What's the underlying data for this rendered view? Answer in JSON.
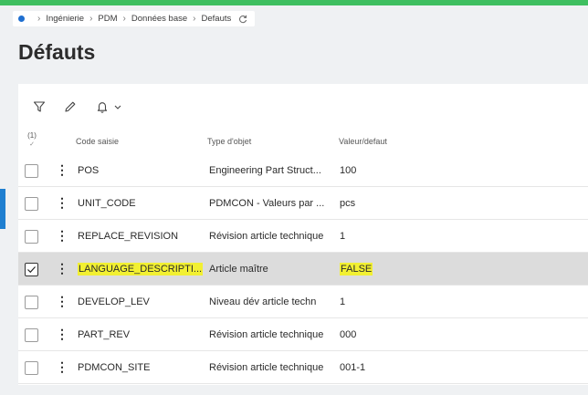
{
  "breadcrumb": {
    "items": [
      "Ingénierie",
      "PDM",
      "Données base",
      "Defauts"
    ]
  },
  "page": {
    "title": "Défauts"
  },
  "toolbar": {
    "icons": [
      "filter-icon",
      "pencil-icon",
      "bell-icon",
      "chevron-down-icon"
    ]
  },
  "table": {
    "selection_count": "(1)",
    "columns": [
      "Code saisie",
      "Type d'objet",
      "Valeur/defaut"
    ],
    "rows": [
      {
        "code": "POS",
        "type": "Engineering Part Struct...",
        "value": "100",
        "checked": false
      },
      {
        "code": "UNIT_CODE",
        "type": "PDMCON - Valeurs par ...",
        "value": "pcs",
        "checked": false
      },
      {
        "code": "REPLACE_REVISION",
        "type": "Révision article technique",
        "value": "1",
        "checked": false
      },
      {
        "code": "LANGUAGE_DESCRIPTI...",
        "type": "Article maître",
        "value": "FALSE",
        "checked": true
      },
      {
        "code": "DEVELOP_LEV",
        "type": "Niveau dév article techn",
        "value": "1",
        "checked": false
      },
      {
        "code": "PART_REV",
        "type": "Révision article technique",
        "value": "000",
        "checked": false
      },
      {
        "code": "PDMCON_SITE",
        "type": "Révision article technique",
        "value": "001-1",
        "checked": false
      }
    ]
  },
  "colors": {
    "accent_green": "#3fbf60",
    "accent_blue": "#1f6fd0",
    "highlight": "#f2f032",
    "selected_row": "#dcdcdc"
  }
}
